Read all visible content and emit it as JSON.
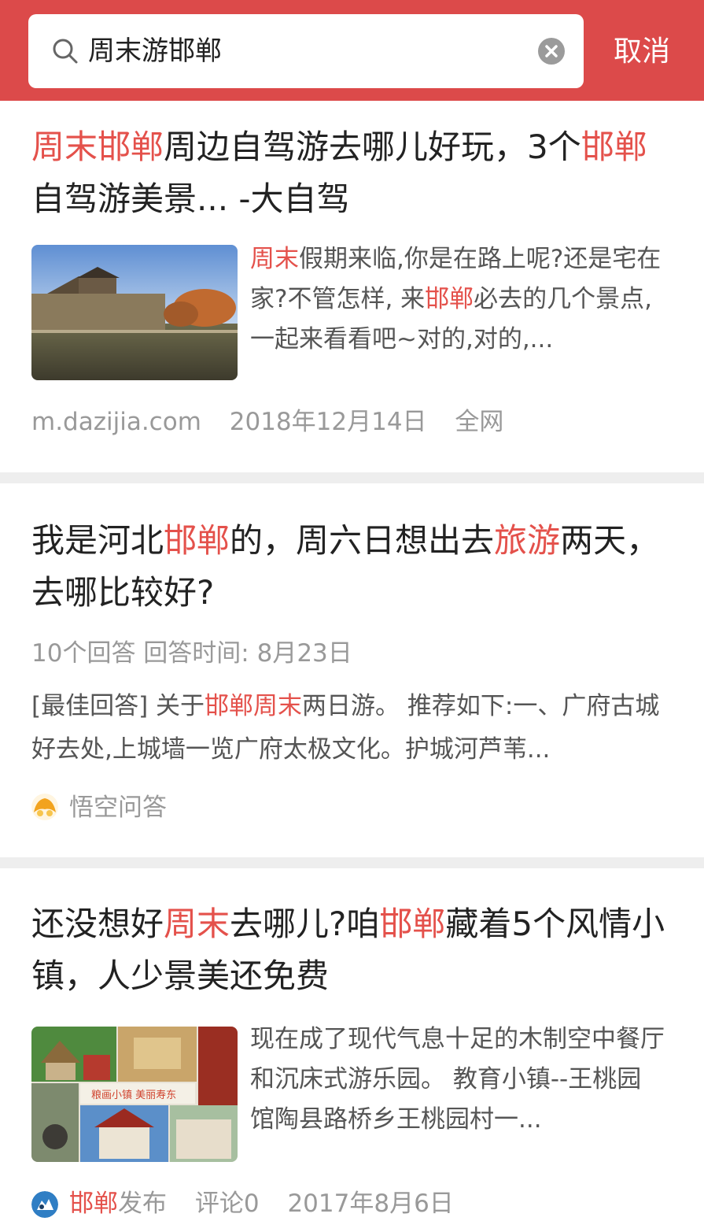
{
  "search": {
    "query": "周末游邯郸",
    "cancel_label": "取消"
  },
  "results": [
    {
      "title_parts": [
        {
          "text": "周末邯郸",
          "hl": true
        },
        {
          "text": "周边自驾游去哪儿好玩，3个",
          "hl": false
        },
        {
          "text": "邯郸",
          "hl": true
        },
        {
          "text": "自驾游美景... -大自驾",
          "hl": false
        }
      ],
      "snippet_parts": [
        {
          "text": "周末",
          "hl": true
        },
        {
          "text": "假期来临,你是在路上呢?还是宅在家?不管怎样, 来",
          "hl": false
        },
        {
          "text": "邯郸",
          "hl": true
        },
        {
          "text": "必去的几个景点,一起来看看吧~对的,对的,...",
          "hl": false
        }
      ],
      "source": "m.dazijia.com",
      "date": "2018年12月14日",
      "scope": "全网"
    },
    {
      "title_parts": [
        {
          "text": "我是河北",
          "hl": false
        },
        {
          "text": "邯郸",
          "hl": true
        },
        {
          "text": "的，周六日想出去",
          "hl": false
        },
        {
          "text": "旅游",
          "hl": true
        },
        {
          "text": "两天，去哪比较好?",
          "hl": false
        }
      ],
      "answer_info": "10个回答 回答时间: 8月23日",
      "snippet_parts": [
        {
          "text": "[最佳回答] 关于",
          "hl": false
        },
        {
          "text": "邯郸周末",
          "hl": true
        },
        {
          "text": "两日游。 推荐如下:一、广府古城好去处,上城墙一览广府太极文化。护城河芦苇...",
          "hl": false
        }
      ],
      "source": "悟空问答"
    },
    {
      "title_parts": [
        {
          "text": "还没想好",
          "hl": false
        },
        {
          "text": "周末",
          "hl": true
        },
        {
          "text": "去哪儿?咱",
          "hl": false
        },
        {
          "text": "邯郸",
          "hl": true
        },
        {
          "text": "藏着5个风情小镇，人少景美还免费",
          "hl": false
        }
      ],
      "snippet_parts": [
        {
          "text": "现在成了现代气息十足的木制空中餐厅和沉床式游乐园。 教育小镇--王桃园 馆陶县路桥乡王桃园村一...",
          "hl": false
        }
      ],
      "source_hl": "邯郸",
      "source_rest": "发布",
      "comments": "评论0",
      "date": "2017年8月6日",
      "thumb_caption": "粮画小镇   美丽寿东"
    }
  ],
  "colors": {
    "header": "#dc4a4a",
    "highlight": "#e4514b",
    "meta_text": "#999999"
  },
  "icons": {
    "search": "search-icon",
    "clear": "clear-icon",
    "wukong": "wukong-avatar-icon",
    "handan": "handan-publisher-icon"
  }
}
